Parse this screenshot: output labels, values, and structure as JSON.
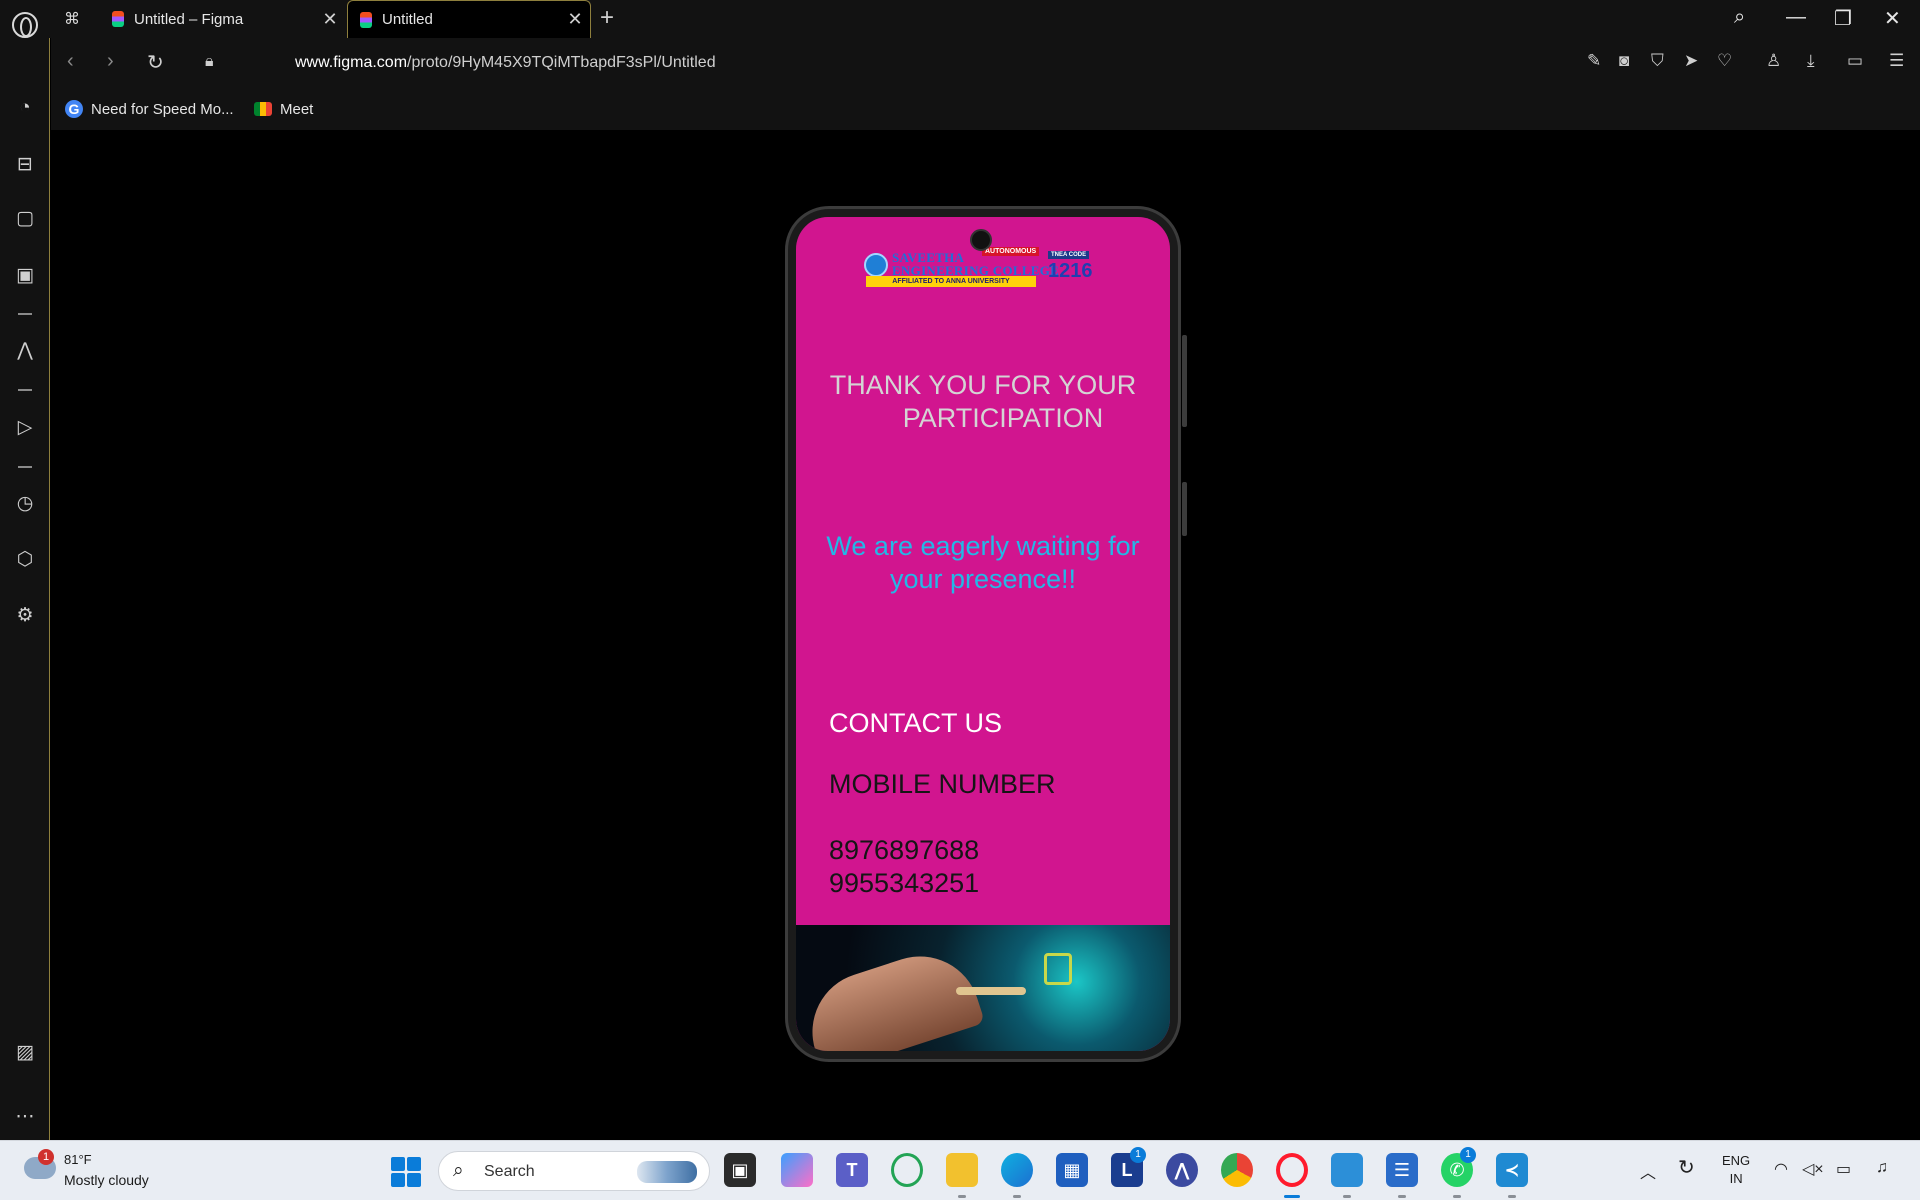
{
  "browser": {
    "tabs": [
      {
        "title": "Untitled – Figma",
        "active": false
      },
      {
        "title": "Untitled",
        "active": true
      }
    ],
    "url": {
      "host": "www.figma.com",
      "path": "/proto/9HyM45X9TQiMTbapdF3sPl/Untitled"
    },
    "bookmarks": [
      {
        "label": "Need for Speed Mo...",
        "icon": "google-icon"
      },
      {
        "label": "Meet",
        "icon": "meet-icon"
      }
    ],
    "accent_color": "#8e7f3d"
  },
  "prototype": {
    "background_color": "#d1158f",
    "logo": {
      "name_line1": "SAVEETHA",
      "name_line2": "ENGINEERING COLLEGE",
      "autonomous": "AUTONOMOUS",
      "affiliated": "AFFILIATED TO ANNA UNIVERSITY",
      "tnea_label": "TNEA CODE",
      "tnea_code": "1216"
    },
    "thanks_line1": "THANK YOU FOR YOUR",
    "thanks_line2": "PARTICIPATION",
    "waiting_line1": "We are eagerly waiting for",
    "waiting_line2": "your presence!!",
    "contact_heading": "CONTACT US",
    "mobile_label": "MOBILE NUMBER",
    "phone_numbers": [
      "8976897688",
      "9955343251"
    ]
  },
  "taskbar": {
    "weather_temp": "81°F",
    "weather_desc": "Mostly cloudy",
    "weather_badge": "1",
    "search_label": "Search",
    "app_badge_l": "1",
    "app_badge_whatsapp": "1",
    "lang_line1": "ENG",
    "lang_line2": "IN"
  }
}
